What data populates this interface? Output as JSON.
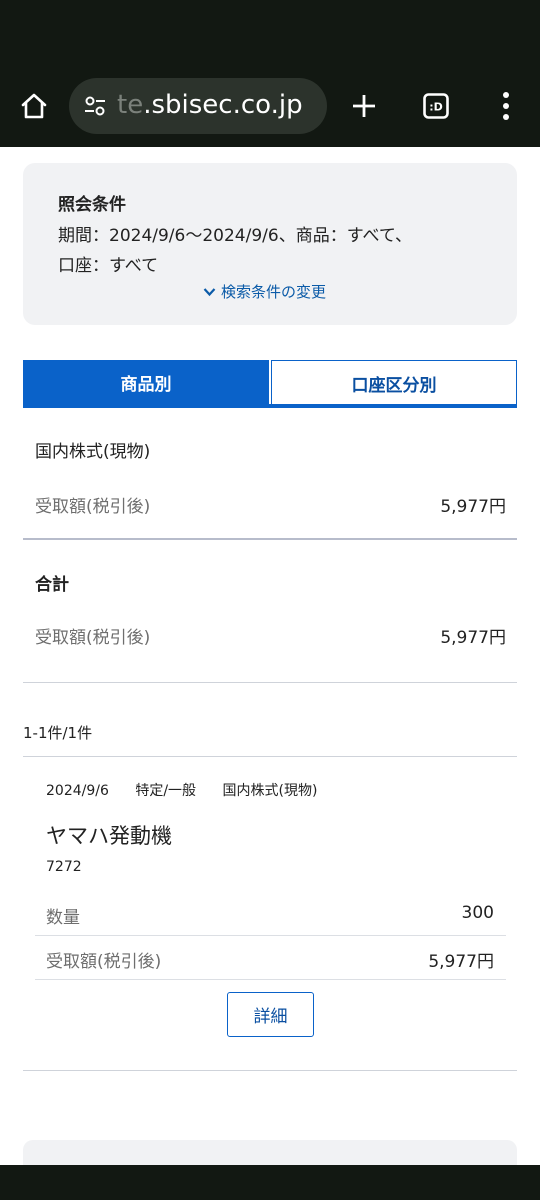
{
  "browser": {
    "url_faded": "te",
    "url_main": ".sbisec.co.jp"
  },
  "conditions": {
    "title": "照会条件",
    "line1": "期間：2024/9/6～2024/9/6、商品：すべて、",
    "line2": "口座：すべて",
    "change_link": "検索条件の変更"
  },
  "tabs": {
    "by_product": "商品別",
    "by_account": "口座区分別"
  },
  "summary": {
    "category": "国内株式(現物)",
    "received_label": "受取額(税引後)",
    "received_value": "5,977円"
  },
  "total": {
    "title": "合計",
    "received_label": "受取額(税引後)",
    "received_value": "5,977円"
  },
  "result_count": "1-1件/1件",
  "item": {
    "date": "2024/9/6",
    "account_type": "特定/一般",
    "product": "国内株式(現物)",
    "name": "ヤマハ発動機",
    "code": "7272",
    "quantity_label": "数量",
    "quantity_value": "300",
    "received_label": "受取額(税引後)",
    "received_value": "5,977円",
    "detail_button": "詳細"
  },
  "icons": {
    "home": "home-icon",
    "site_settings": "tune-icon",
    "new_tab": "plus-icon",
    "tab_switcher": "tab-switcher-icon",
    "menu": "more-vert-icon",
    "expand": "chevron-down-icon"
  },
  "colors": {
    "accent": "#0a62c9",
    "chrome": "#121812",
    "panel": "#f1f2f4"
  }
}
